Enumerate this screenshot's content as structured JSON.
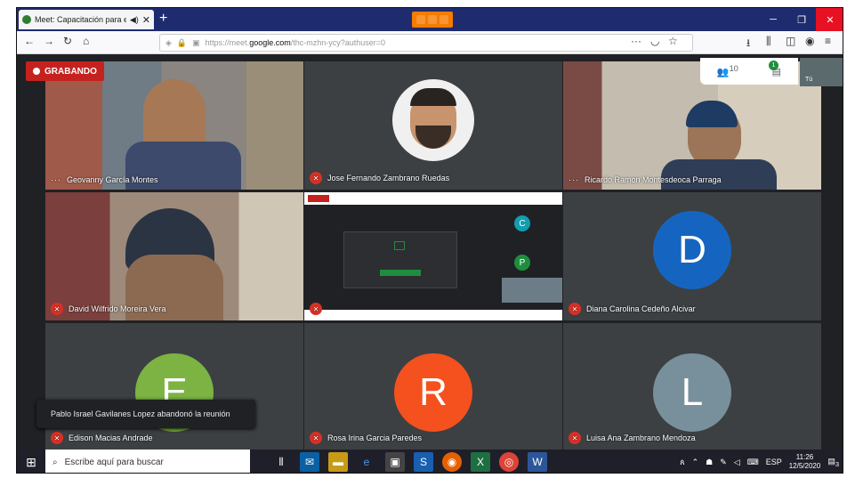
{
  "browser": {
    "tab_title": "Meet: Capacitación para el",
    "url_prefix": "https://meet.",
    "url_host": "google.com",
    "url_path": "/thc-mzhn-ycy?authuser=0"
  },
  "meet": {
    "recording_label": "GRABANDO",
    "participant_count": "10",
    "chat_badge": "1",
    "self_label": "Tú",
    "toast": "Pablo Israel Gavilanes Lopez abandonó la reunión",
    "tiles": [
      {
        "name": "Geovanny García Montes",
        "muted": false
      },
      {
        "name": "Jose Fernando Zambrano Ruedas",
        "muted": true
      },
      {
        "name": "Ricardo Ramon Montesdeoca Parraga",
        "muted": false
      },
      {
        "name": "David Wilfrido Moreira Vera",
        "muted": true
      },
      {
        "name": "",
        "muted": true
      },
      {
        "name": "Diana Carolina Cedeño Alcivar",
        "muted": true,
        "initial": "D",
        "color": "#1565c0"
      },
      {
        "name": "Edison Macias Andrade",
        "muted": true,
        "initial": "E",
        "color": "#7cb342"
      },
      {
        "name": "Rosa Irina Garcia Paredes",
        "muted": true,
        "initial": "R",
        "color": "#f4511e"
      },
      {
        "name": "Luisa Ana Zambrano Mendoza",
        "muted": true,
        "initial": "L",
        "color": "#78909c"
      }
    ],
    "share_initials": [
      "C",
      "P"
    ]
  },
  "taskbar": {
    "search_placeholder": "Escribe aquí para buscar",
    "lang": "ESP",
    "time": "11:26",
    "date": "12/5/2020",
    "notif_count": "3"
  }
}
